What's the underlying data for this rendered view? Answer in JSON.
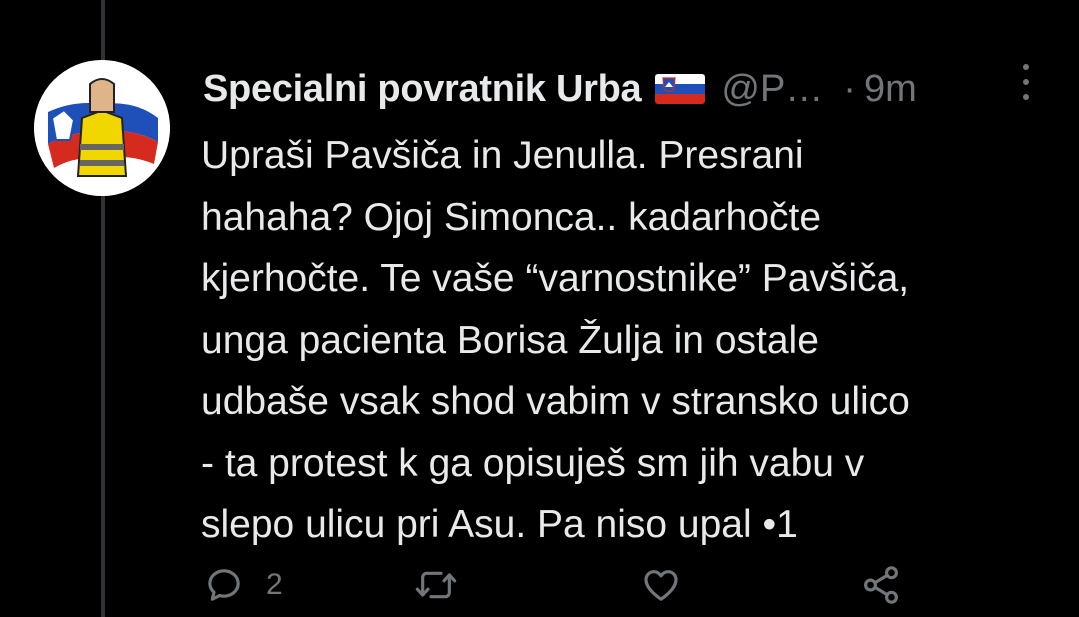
{
  "tweet": {
    "display_name": "Specialni povratnik Urba",
    "flag_icon": "slovenia-flag-icon",
    "handle": "@P…",
    "separator": "·",
    "time": "9m",
    "text_lines": [
      "Upraši Pavšiča in Jenulla. Presrani",
      "hahaha? Ojoj Simonca.. kadarhočte",
      "kjerhočte. Te vaše “varnostnike” Pavšiča,",
      "unga pacienta Borisa Žulja in ostale",
      "udbaše vsak shod vabim v stransko ulico",
      "- ta protest k ga opisuješ sm jih vabu v",
      "slepo ulicu pri Asu. Pa niso upal •1"
    ]
  },
  "actions": {
    "reply": {
      "icon": "reply-icon",
      "count": "2"
    },
    "retweet": {
      "icon": "retweet-icon",
      "count": ""
    },
    "like": {
      "icon": "like-icon",
      "count": ""
    },
    "share": {
      "icon": "share-icon",
      "count": ""
    }
  },
  "colors": {
    "background": "#000000",
    "text_primary": "#e7e9ea",
    "text_secondary": "#71767b",
    "thread_line": "#2f3336"
  }
}
